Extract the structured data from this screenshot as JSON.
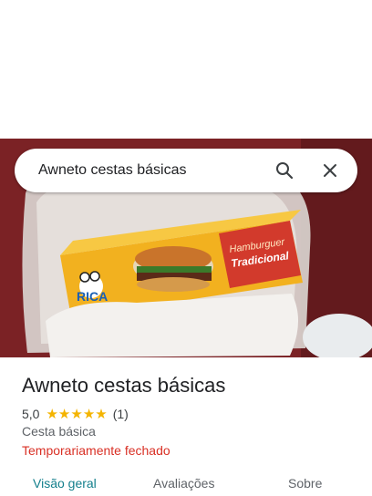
{
  "search": {
    "value": "Awneto cestas básicas",
    "icons": {
      "search": "search-icon",
      "clear": "close-icon"
    }
  },
  "photo": {
    "box_brand": "RICA",
    "box_text_line1": "Hamburguer",
    "box_text_line2": "Tradicional"
  },
  "place": {
    "name": "Awneto cestas básicas",
    "rating": "5,0",
    "stars": 5,
    "review_count": "(1)",
    "category": "Cesta básica",
    "status": "Temporariamente fechado"
  },
  "tabs": {
    "overview": "Visão geral",
    "reviews": "Avaliações",
    "about": "Sobre"
  },
  "colors": {
    "star": "#f4b400",
    "status_closed": "#d93025",
    "active_tab": "#137f8c"
  }
}
